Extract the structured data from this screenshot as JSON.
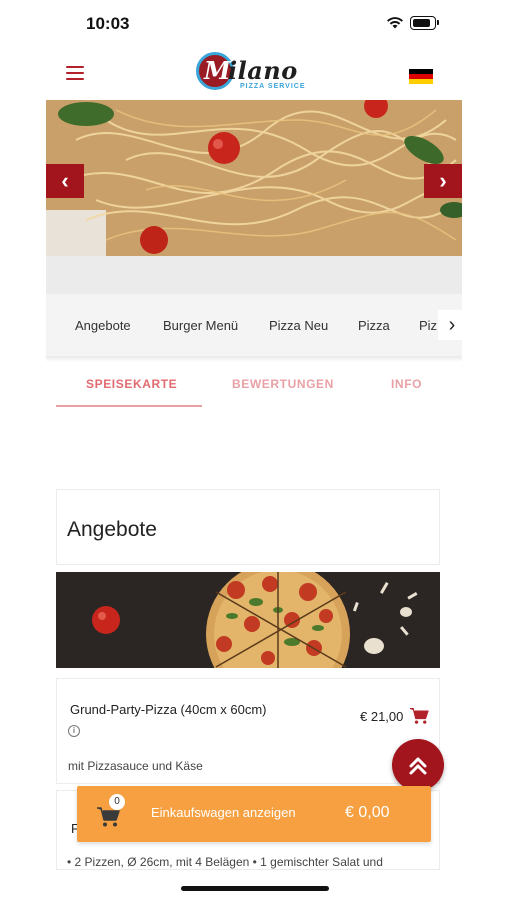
{
  "status_bar": {
    "time": "10:03"
  },
  "header": {
    "logo_text": "ilano",
    "logo_letter": "M",
    "logo_subtitle": "PIZZA SERVICE",
    "language_flag": "german-flag-icon"
  },
  "hero": {
    "prev_label": "‹",
    "next_label": "›"
  },
  "categories": {
    "items": [
      "Angebote",
      "Burger Menü",
      "Pizza Neu",
      "Pizza",
      "Piz"
    ],
    "next_label": "›"
  },
  "tabs": [
    {
      "label": "SPEISEKARTE",
      "active": true
    },
    {
      "label": "BEWERTUNGEN",
      "active": false
    },
    {
      "label": "INFO",
      "active": false
    }
  ],
  "section": {
    "title": "Angebote"
  },
  "product": {
    "name": "Grund-Party-Pizza (40cm x 60cm)",
    "info_symbol": "i",
    "description": "mit Pizzasauce und Käse",
    "price": "€ 21,00"
  },
  "next_product": {
    "name_visible": "F",
    "description": "• 2 Pizzen, Ø 26cm, mit 4 Belägen • 1 gemischter Salat und"
  },
  "cart_bar": {
    "badge_count": "0",
    "label": "Einkaufswagen anzeigen",
    "total": "€ 0,00"
  },
  "colors": {
    "brand_red": "#a3151d",
    "tab_pink": "#e16b71",
    "cart_orange": "#f7a042"
  }
}
